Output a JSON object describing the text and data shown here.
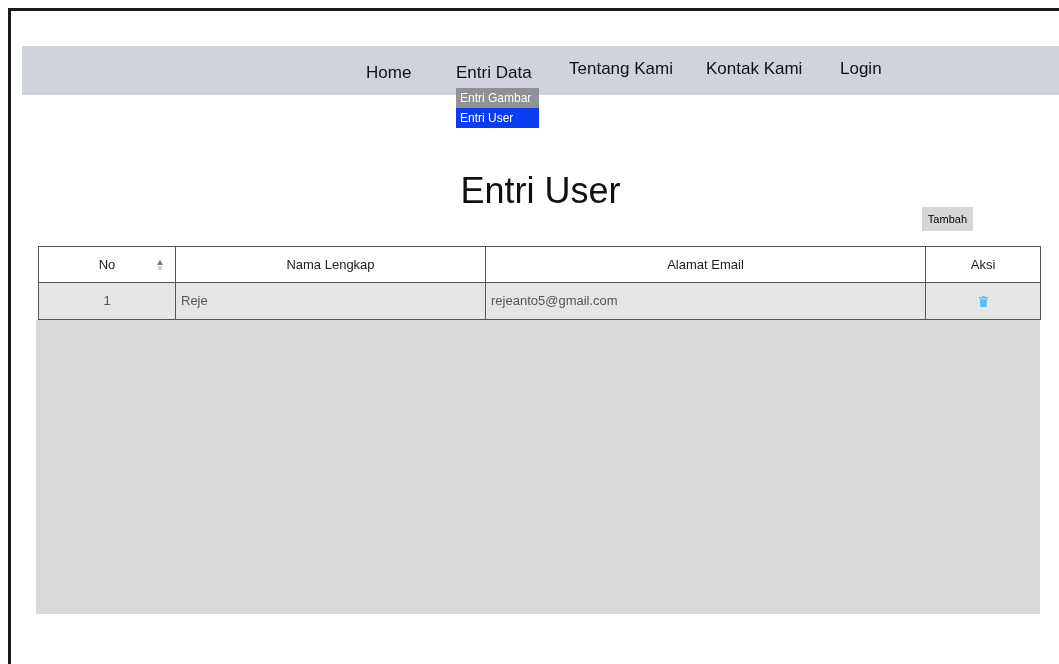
{
  "nav": {
    "items": [
      {
        "label": "Home"
      },
      {
        "label": "Entri Data",
        "children": [
          {
            "label": "Entri Gambar",
            "selected": false
          },
          {
            "label": "Entri User",
            "selected": true
          }
        ]
      },
      {
        "label": "Tentang Kami"
      },
      {
        "label": "Kontak Kami"
      },
      {
        "label": "Login"
      }
    ]
  },
  "title": "Entri User",
  "add_button": "Tambah",
  "table": {
    "columns": [
      "No",
      "Nama Lengkap",
      "Alamat Email",
      "Aksi"
    ],
    "rows": [
      {
        "no": "1",
        "name": "Reje",
        "email": "rejeanto5@gmail.com"
      }
    ]
  }
}
